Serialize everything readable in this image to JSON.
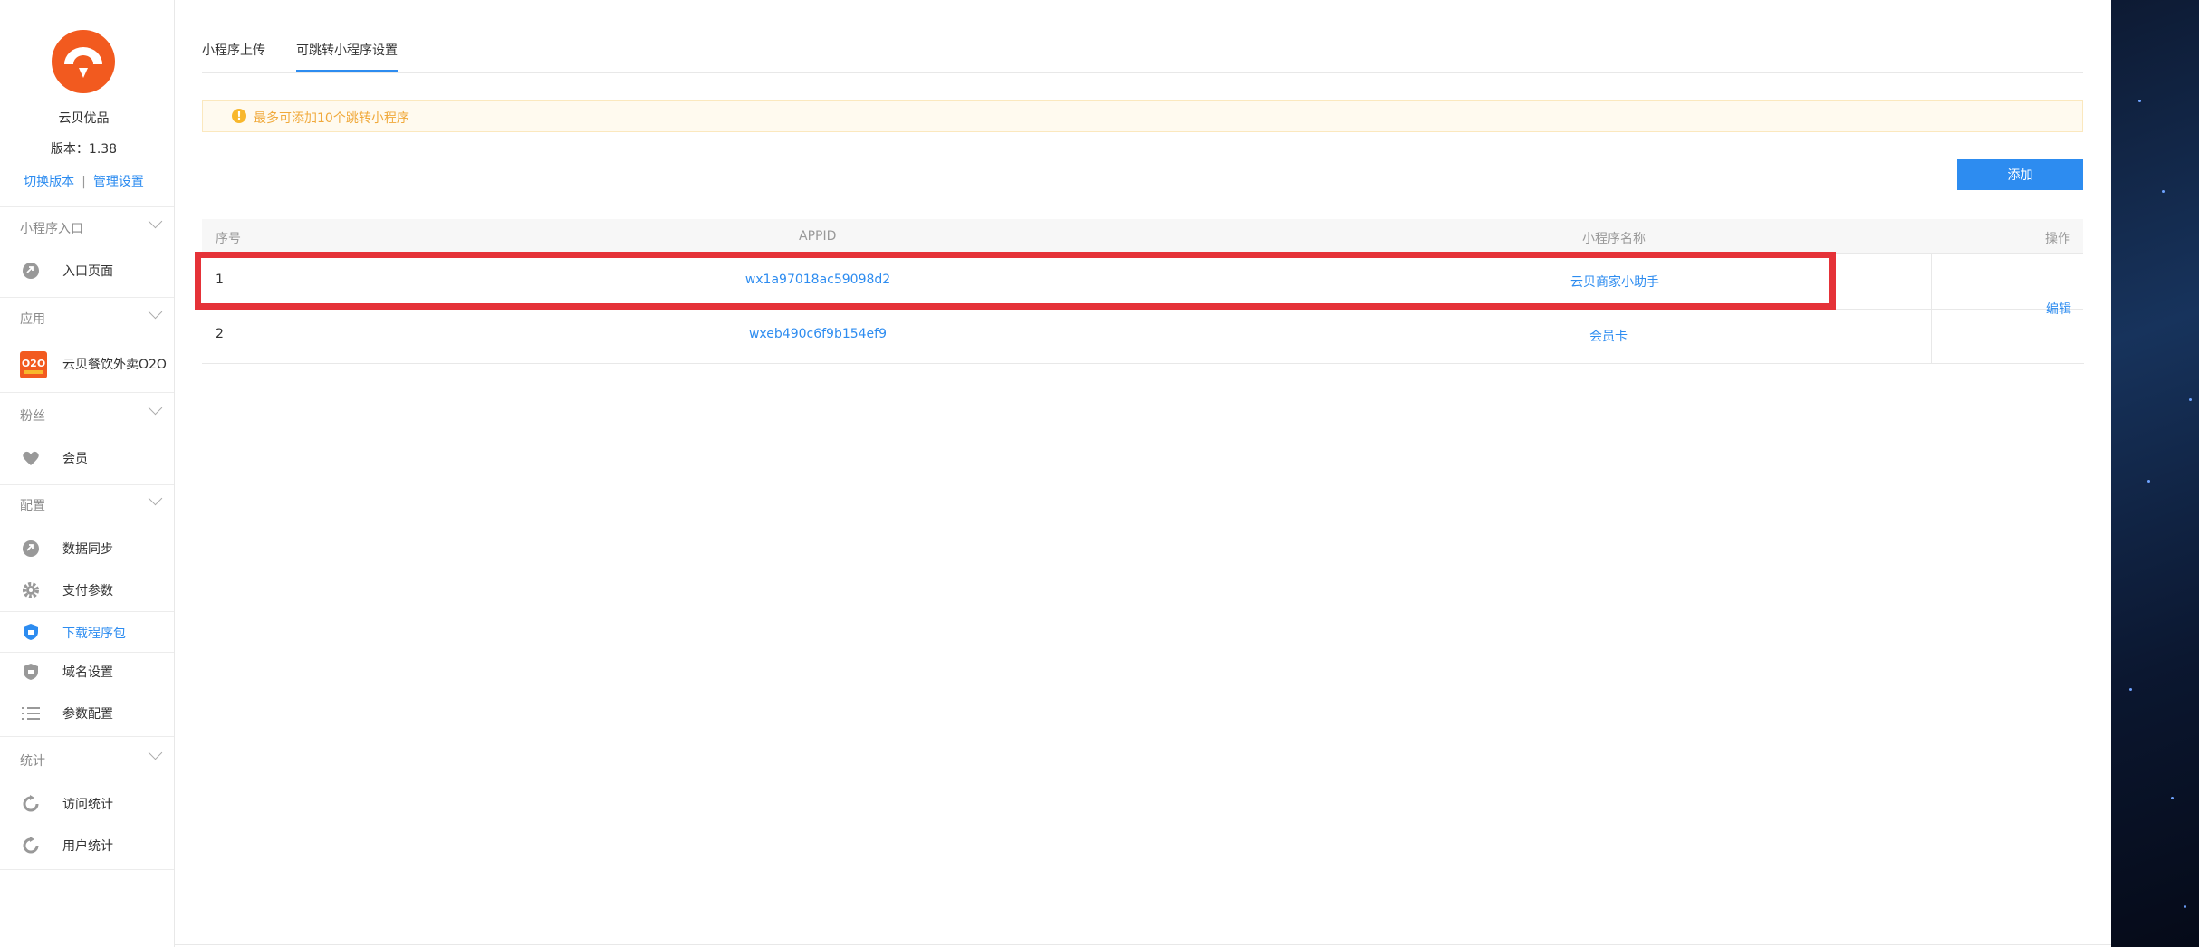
{
  "app": {
    "name": "云贝优品",
    "version": "版本：1.38",
    "switch_version": "切换版本",
    "separator": "|",
    "manage_settings": "管理设置"
  },
  "sidebar": {
    "sections": [
      {
        "title": "小程序入口",
        "items": [
          {
            "label": "入口页面",
            "icon": "link-icon"
          }
        ]
      },
      {
        "title": "应用",
        "items": [
          {
            "label": "云贝餐饮外卖O2O",
            "icon": "o2o-app-icon"
          }
        ]
      },
      {
        "title": "粉丝",
        "items": [
          {
            "label": "会员",
            "icon": "heart-icon"
          }
        ]
      },
      {
        "title": "配置",
        "items": [
          {
            "label": "数据同步",
            "icon": "sync-link-icon"
          },
          {
            "label": "支付参数",
            "icon": "gear-icon"
          },
          {
            "label": "下载程序包",
            "icon": "shield-icon",
            "active": true
          },
          {
            "label": "域名设置",
            "icon": "shield-icon"
          },
          {
            "label": "参数配置",
            "icon": "list-icon"
          }
        ]
      },
      {
        "title": "统计",
        "items": [
          {
            "label": "访问统计",
            "icon": "refresh-icon"
          },
          {
            "label": "用户统计",
            "icon": "refresh-icon"
          }
        ]
      }
    ]
  },
  "tabs": [
    {
      "label": "小程序上传",
      "active": false
    },
    {
      "label": "可跳转小程序设置",
      "active": true
    }
  ],
  "notice": {
    "icon": "!",
    "text": "最多可添加10个跳转小程序"
  },
  "add_button": "添加",
  "table": {
    "columns": [
      "序号",
      "APPID",
      "小程序名称",
      "操作"
    ],
    "rows": [
      {
        "index": "1",
        "appid": "wx1a97018ac59098d2",
        "name": "云贝商家小助手"
      },
      {
        "index": "2",
        "appid": "wxeb490c6f9b154ef9",
        "name": "会员卡"
      }
    ],
    "edit_label": "编辑"
  },
  "colors": {
    "accent": "#2d8cf0",
    "logo": "#f25a1f",
    "highlight": "#e53238",
    "warning": "#f0a93b"
  }
}
